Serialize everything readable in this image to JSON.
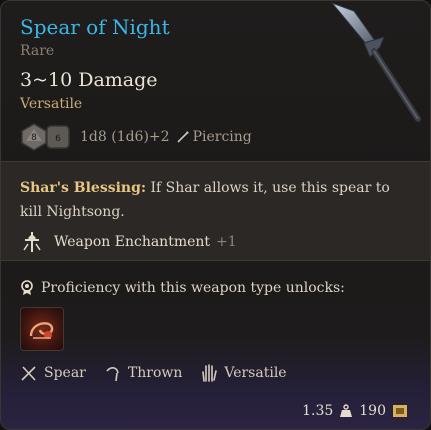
{
  "item": {
    "name": "Spear of Night",
    "rarity": "Rare",
    "damage": "3~10 Damage",
    "property": "Versatile",
    "die_left": "8",
    "die_right": "6",
    "dice_formula": "1d8 (1d6)+2",
    "damage_type": "Piercing"
  },
  "blessing": {
    "name": "Shar's Blessing:",
    "text": " If Shar allows it, use this spear to kill Nightsong.",
    "enchant_label": "Weapon Enchantment",
    "enchant_bonus": "+1"
  },
  "proficiency": {
    "label": "Proficiency with this weapon type unlocks:"
  },
  "weapon_types": [
    {
      "label": "Spear",
      "icon": "spear-icon"
    },
    {
      "label": "Thrown",
      "icon": "thrown-icon"
    },
    {
      "label": "Versatile",
      "icon": "versatile-hand-icon"
    }
  ],
  "footer": {
    "weight": "1.35",
    "value": "190"
  },
  "colors": {
    "title": "#3bb6e6",
    "rarity": "#8c7f70",
    "property": "#c9ad7a",
    "blessing_name": "#e8c684"
  }
}
